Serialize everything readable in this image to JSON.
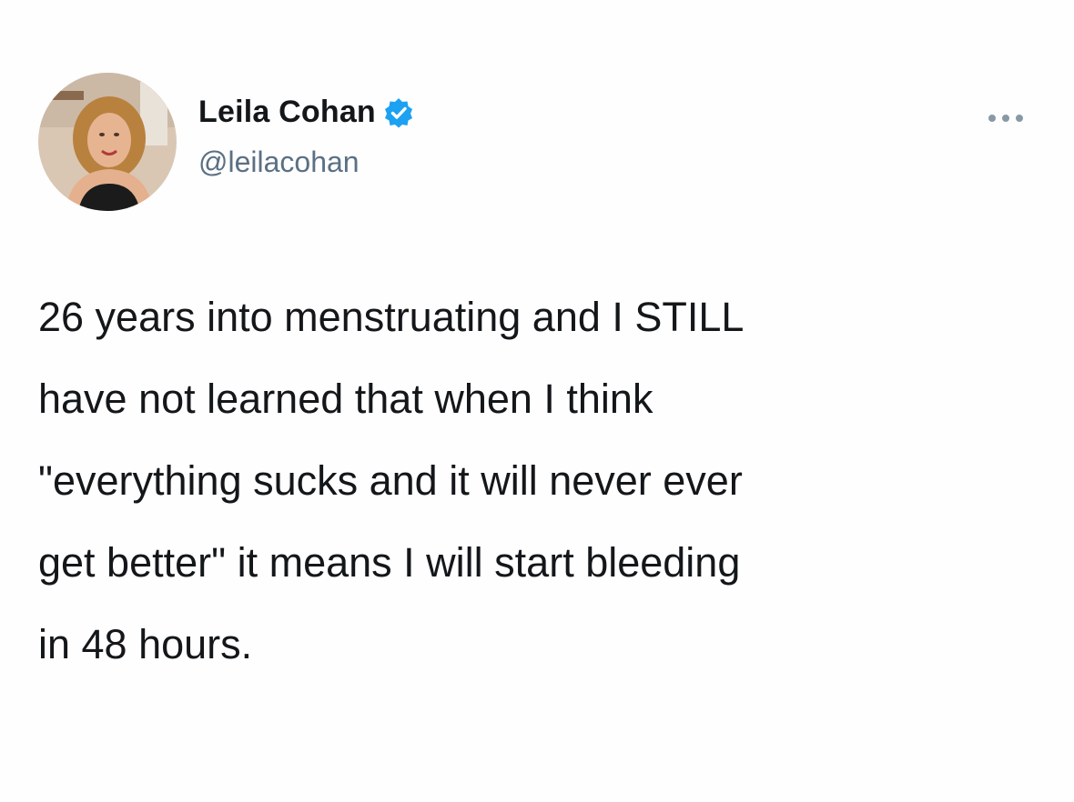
{
  "tweet": {
    "author": {
      "display_name": "Leila Cohan",
      "handle": "@leilacohan",
      "verified": true,
      "avatar_icon": "profile-photo"
    },
    "more_icon": "more-options-icon",
    "text_lines": [
      "26 years into menstruating and I STILL",
      "have not learned that when I think",
      "\"everything sucks and it will never ever",
      "get better\" it means I will start bleeding",
      "in 48 hours."
    ]
  },
  "colors": {
    "background": "#fefefe",
    "text": "#14171a",
    "secondary_text": "#5b7083",
    "verified_badge": "#1da1f2"
  }
}
